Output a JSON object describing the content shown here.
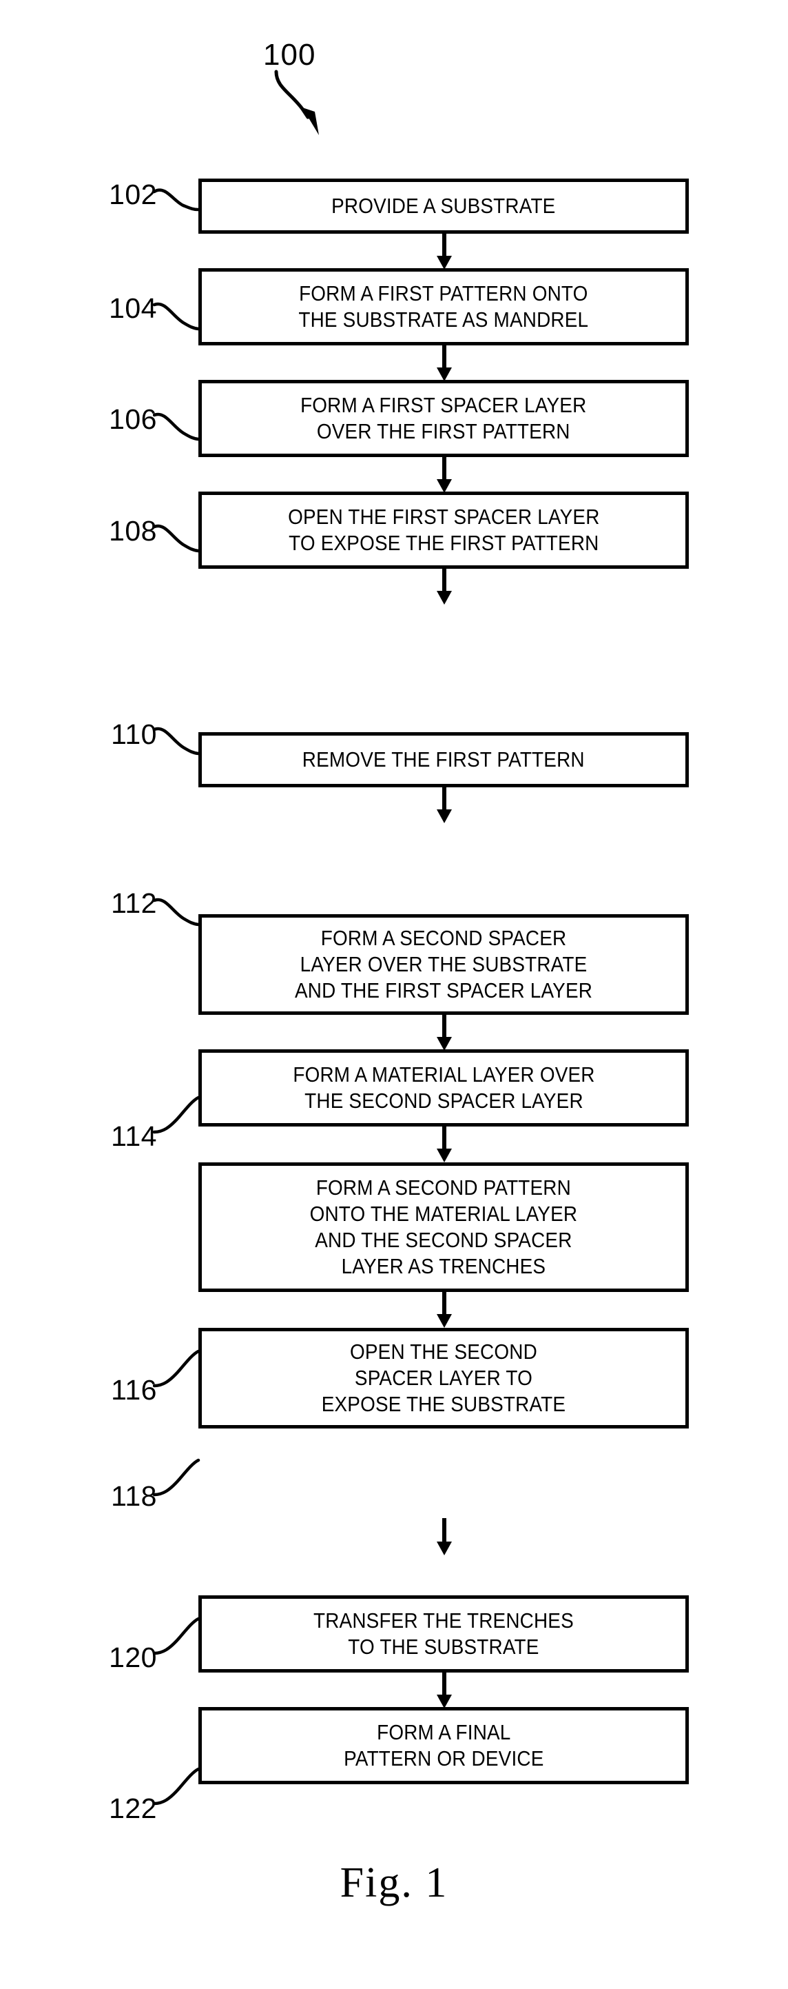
{
  "figure": {
    "number_label": "100",
    "caption": "Fig. 1"
  },
  "flowchart": {
    "type": "process-flow",
    "orientation": "vertical",
    "steps": [
      {
        "ref": "102",
        "text": "PROVIDE A SUBSTRATE",
        "lines": 1
      },
      {
        "ref": "104",
        "text": "FORM A FIRST PATTERN ONTO\nTHE SUBSTRATE AS MANDREL",
        "lines": 2
      },
      {
        "ref": "106",
        "text": "FORM A FIRST SPACER LAYER\nOVER THE FIRST PATTERN",
        "lines": 2
      },
      {
        "ref": "108",
        "text": "OPEN THE FIRST SPACER LAYER\nTO EXPOSE THE FIRST PATTERN",
        "lines": 2
      },
      {
        "ref": "110",
        "text": "REMOVE THE FIRST PATTERN",
        "lines": 1
      },
      {
        "ref": "112",
        "text": "FORM A SECOND SPACER\nLAYER OVER THE SUBSTRATE\nAND THE FIRST SPACER LAYER",
        "lines": 3
      },
      {
        "ref": "114",
        "text": "FORM A MATERIAL LAYER OVER\nTHE SECOND SPACER LAYER",
        "lines": 2
      },
      {
        "ref": "116",
        "text": "FORM A SECOND PATTERN\nONTO THE MATERIAL LAYER\nAND THE SECOND SPACER\nLAYER AS TRENCHES",
        "lines": 4
      },
      {
        "ref": "118",
        "text": "OPEN THE SECOND\nSPACER LAYER TO\nEXPOSE THE SUBSTRATE",
        "lines": 3
      },
      {
        "ref": "120",
        "text": "TRANSFER THE TRENCHES\nTO THE SUBSTRATE",
        "lines": 2
      },
      {
        "ref": "122",
        "text": "FORM A FINAL\nPATTERN OR DEVICE",
        "lines": 2
      }
    ]
  },
  "colors": {
    "stroke": "#000000",
    "background": "#ffffff"
  }
}
